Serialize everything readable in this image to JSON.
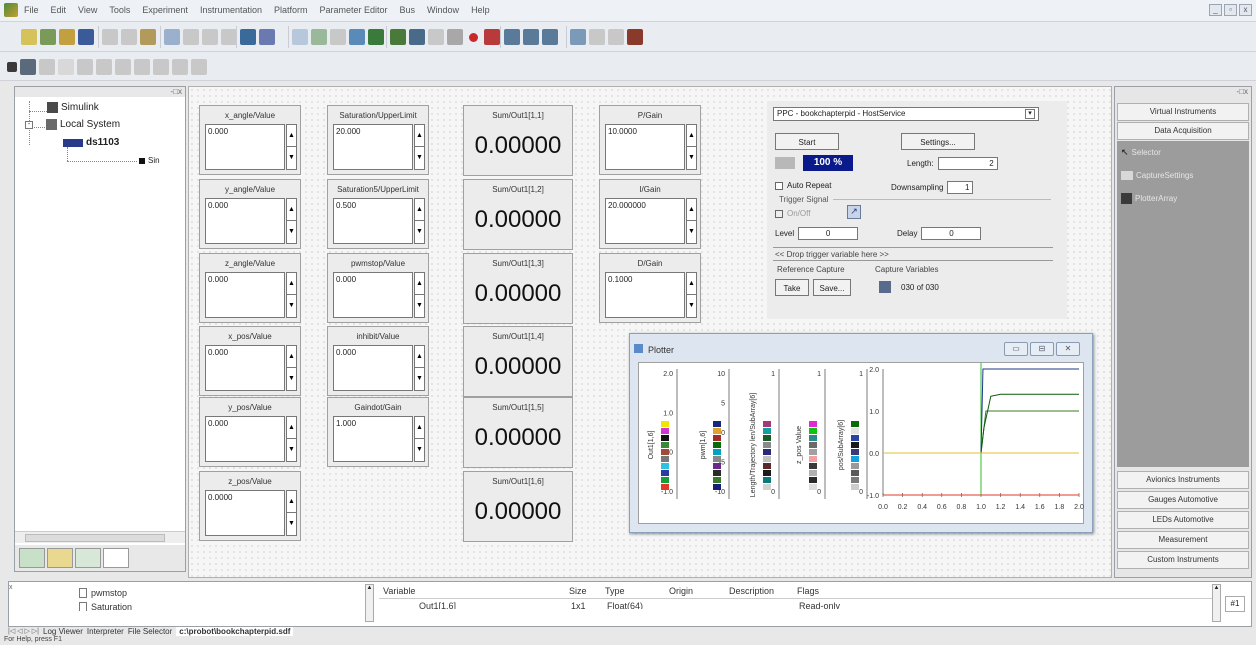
{
  "menubar": {
    "items": [
      "File",
      "Edit",
      "View",
      "Tools",
      "Experiment",
      "Instrumentation",
      "Platform",
      "Parameter Editor",
      "Bus",
      "Window",
      "Help"
    ]
  },
  "tree": {
    "items": [
      "Simulink",
      "Local System",
      "ds1103",
      "Sin"
    ]
  },
  "inputs": [
    {
      "label": "x_angle/Value",
      "value": "0.000"
    },
    {
      "label": "y_angle/Value",
      "value": "0.000"
    },
    {
      "label": "z_angle/Value",
      "value": "0.000"
    },
    {
      "label": "x_pos/Value",
      "value": "0.000"
    },
    {
      "label": "y_pos/Value",
      "value": "0.000"
    },
    {
      "label": "z_pos/Value",
      "value": "0.0000"
    },
    {
      "label": "Saturation/UpperLimit",
      "value": "20.000"
    },
    {
      "label": "Saturation5/UpperLimit",
      "value": "0.500"
    },
    {
      "label": "pwmstop/Value",
      "value": "0.000"
    },
    {
      "label": "inhibit/Value",
      "value": "0.000"
    },
    {
      "label": "Gaindot/Gain",
      "value": "1.000"
    },
    {
      "label": "P/Gain",
      "value": "10.0000"
    },
    {
      "label": "I/Gain",
      "value": "20.000000"
    },
    {
      "label": "D/Gain",
      "value": "0.1000"
    }
  ],
  "displays": [
    {
      "label": "Sum/Out1[1,1]",
      "value": "0.00000"
    },
    {
      "label": "Sum/Out1[1,2]",
      "value": "0.00000"
    },
    {
      "label": "Sum/Out1[1,3]",
      "value": "0.00000"
    },
    {
      "label": "Sum/Out1[1,4]",
      "value": "0.00000"
    },
    {
      "label": "Sum/Out1[1,5]",
      "value": "0.00000"
    },
    {
      "label": "Sum/Out1[1,6]",
      "value": "0.00000"
    }
  ],
  "capture": {
    "service": "PPC - bookchapterpid - HostService",
    "start": "Start",
    "settings": "Settings...",
    "progress": "100 %",
    "length_label": "Length:",
    "length_value": "2",
    "auto_repeat": "Auto Repeat",
    "downsampling_label": "Downsampling",
    "downsampling_value": "1",
    "trigger_signal": "Trigger Signal",
    "on_off": "On/Off",
    "level_label": "Level",
    "level_value": "0",
    "delay_label": "Delay",
    "delay_value": "0",
    "drop_trigger": "<< Drop trigger variable here >>",
    "reference_capture": "Reference Capture",
    "take": "Take",
    "save": "Save...",
    "capture_variables": "Capture Variables",
    "capture_count": "030 of 030"
  },
  "plotter": {
    "title": "Plotter",
    "axes": [
      {
        "label": "Out1[1,6]",
        "ticks": [
          "2.0",
          "1.0",
          "0.0",
          "-1.0"
        ]
      },
      {
        "label": "pwm[1,6]",
        "ticks": [
          "10",
          "5",
          "0",
          "-5",
          "-10"
        ]
      },
      {
        "label": "Length/Trajectory len/SubArray[6]",
        "ticks": [
          "1",
          "0"
        ]
      },
      {
        "label": "z_pos Value",
        "ticks": [
          "1",
          "0"
        ]
      },
      {
        "label": "pos/SubArray[6]",
        "ticks": [
          "1",
          "0"
        ]
      }
    ],
    "plot_yticks": [
      "2.0",
      "1.0",
      "0.0",
      "-1.0"
    ],
    "plot_xticks": [
      "0.0",
      "0.2",
      "0.4",
      "0.6",
      "0.8",
      "1.0",
      "1.2",
      "1.4",
      "1.6",
      "1.8",
      "2.0"
    ],
    "swatch_colors": [
      [
        "#f2e600",
        "#d433d4",
        "#111111",
        "#3a8a3a",
        "#a04a3a",
        "#777777",
        "#2ec2e2",
        "#2a3aa0",
        "#12a03a",
        "#e23a2a"
      ],
      [
        "#112a80",
        "#e2a230",
        "#a42a2a",
        "#0a6a0a",
        "#00a2c2",
        "#888888",
        "#6a2a8a",
        "#2a2a2a",
        "#3a7a2a",
        "#1a1a7a"
      ],
      [
        "#a03a7a",
        "#13a0a0",
        "#1a5a2a",
        "#8a8a8a",
        "#2a2a7a",
        "#c2c2c2",
        "#5a2a2a",
        "#1a1a1a",
        "#0a7a7a",
        "#d2d2d2"
      ],
      [
        "#e22ad2",
        "#12c212",
        "#2a8a8a",
        "#6a6a6a",
        "#a0a0a0",
        "#f0a0a0",
        "#3a3a3a",
        "#b0b0b0",
        "#2a2a2a",
        "#dddddd"
      ],
      [
        "#0a6a0a",
        "#e2e2e2",
        "#2a42a2",
        "#1a1a1a",
        "#3a3a7a",
        "#12a2e2",
        "#9a9a9a",
        "#5a5a5a",
        "#7a7a7a",
        "#cccccc"
      ]
    ]
  },
  "right_panel": {
    "header_buttons": [
      "Virtual Instruments",
      "Data Acquisition"
    ],
    "items": [
      "Selector",
      "CaptureSettings",
      "PlotterArray"
    ],
    "footer_buttons": [
      "Avionics Instruments",
      "Gauges Automotive",
      "LEDs Automotive",
      "Measurement",
      "Custom Instruments"
    ]
  },
  "bottom": {
    "tree_items": [
      "pwmstop",
      "Saturation"
    ],
    "columns": [
      "Variable",
      "Size",
      "Type",
      "Origin",
      "Description",
      "Flags"
    ],
    "row": {
      "variable": "Out1[1,6]",
      "size": "1x1",
      "type": "Float(64)",
      "flags": "Read-only"
    },
    "page_indicator": "#1",
    "tabs": [
      "Log Viewer",
      "Interpreter",
      "File Selector",
      "c:\\probot\\bookchapterpid.sdf"
    ]
  },
  "status": "For Help, press F1"
}
